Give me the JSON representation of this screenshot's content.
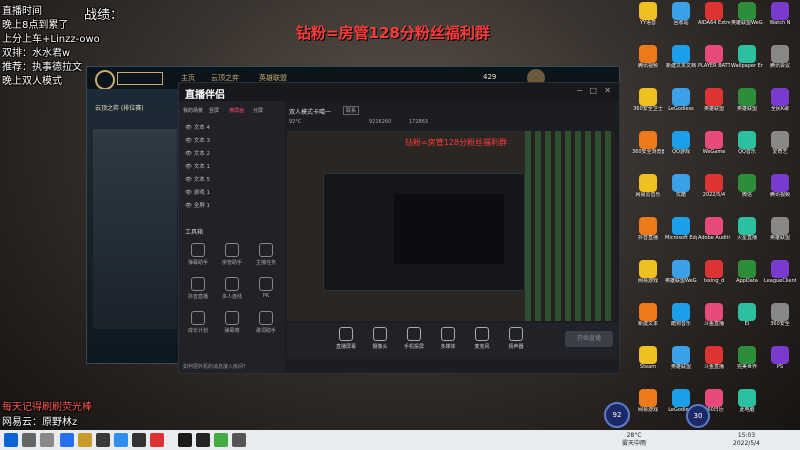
{
  "overlay": {
    "left_lines": [
      "直播时间",
      "晚上8点到累了",
      "上分上车+Linzz-owo",
      "双排：水水君w",
      "推荐：执事德拉文",
      "晚上双人模式"
    ],
    "score_title": "战绩：",
    "banner": "钻粉=房管128分粉丝福利群",
    "bottom_lines": [
      "每天记得刷刷荧光棒",
      "网易云：原野林z"
    ]
  },
  "game_client": {
    "mode_label": "云顶之弈 (排位赛)",
    "nav": [
      "主页",
      "云顶之弈",
      "英雄联盟"
    ],
    "currency": "429"
  },
  "stream_app": {
    "logo": "直播伴侣",
    "tabs": [
      "我的场景",
      "竖屏",
      "横屏画",
      "分屏"
    ],
    "sources": [
      "文本 4",
      "文本 3",
      "文本 2",
      "文本 1",
      "文本 5",
      "游戏 1",
      "全屏 1"
    ],
    "tools_title": "工具箱",
    "tools": [
      "弹幕助手",
      "房管助手",
      "主播任务",
      "抖音直播",
      "多人连线",
      "PK",
      "成长计划",
      "弹幕墙",
      "歌词助手",
      "",
      "",
      ""
    ],
    "stream_header": "双人模式卡噶一",
    "stream_tag": "联系",
    "stats": [
      "92°C",
      "9216260",
      "172863"
    ],
    "bottom_buttons": [
      "直播屏幕",
      "摄像头",
      "手机投屏",
      "多媒体",
      "麦克风",
      "扬声器"
    ],
    "start_button": "开始直播",
    "status_text": "如何把外机的消息接入房间？"
  },
  "desktop_icons": [
    "YY语音",
    "回收站",
    "AIDA64 Extreme",
    "英雄联盟WeGame",
    "Watch N",
    "腾讯视频",
    "新建文本文档",
    "PLAYER BATTLEGR.",
    "Wallpaper Engine",
    "腾讯会议",
    "360安全卫士",
    "LeGodless",
    "英雄联盟",
    "英雄联盟",
    "全民K歌",
    "360安全浏览器",
    "QQ游戏",
    "WeGame",
    "QQ音乐",
    "爱奇艺",
    "网易云音乐",
    "优酷",
    "2022/5/4",
    "微信",
    "腾讯视频",
    "抖音直播",
    "Microsoft Edge",
    "Adobe Audition",
    "火星直播",
    "英雄联盟",
    "网易游戏",
    "英雄联盟WeGame",
    "lsxing_d",
    "AppData",
    "LeagueClient",
    "新建文本",
    "酷狗音乐",
    "斗鱼直播",
    "Ei",
    "360安全",
    "Steam",
    "英雄联盟",
    "斗鱼直播",
    "完美世界",
    "PS",
    "网易游戏",
    "LeGodless",
    "360日历",
    "此电脑"
  ],
  "bubbles": [
    "92",
    "30"
  ],
  "taskbar": {
    "weather": [
      "28°C",
      "雾天中雨"
    ],
    "clock": [
      "15:03",
      "2022/5/4"
    ]
  }
}
